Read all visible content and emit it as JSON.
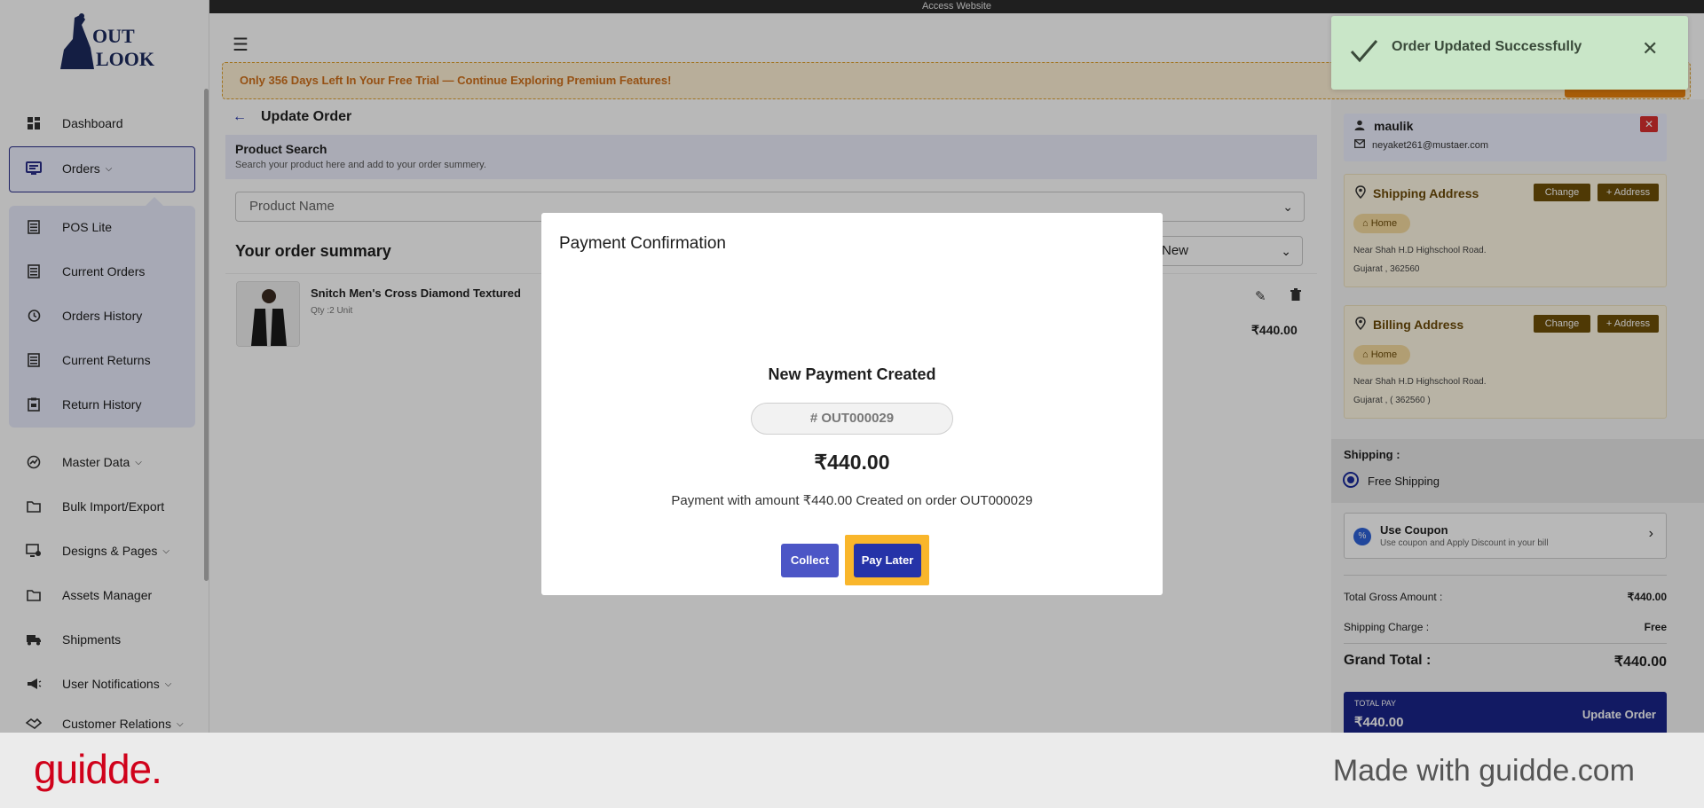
{
  "topbar": {
    "access_label": "Access Website"
  },
  "trial_banner": {
    "text": "Only 356 Days Left In Your Free Trial — Continue Exploring Premium Features!"
  },
  "sidebar": {
    "items": [
      {
        "label": "Dashboard",
        "icon": "dashboard-icon"
      },
      {
        "label": "Orders",
        "icon": "orders-icon"
      },
      {
        "label": "Master Data",
        "icon": "master-data-icon"
      },
      {
        "label": "Bulk Import/Export",
        "icon": "folder-icon"
      },
      {
        "label": "Designs & Pages",
        "icon": "designs-icon"
      },
      {
        "label": "Assets Manager",
        "icon": "folder-icon"
      },
      {
        "label": "Shipments",
        "icon": "truck-icon"
      },
      {
        "label": "User Notifications",
        "icon": "megaphone-icon"
      },
      {
        "label": "Customer Relations",
        "icon": "handshake-icon"
      }
    ],
    "orders_sub": [
      {
        "label": "POS Lite"
      },
      {
        "label": "Current Orders"
      },
      {
        "label": "Orders History"
      },
      {
        "label": "Current Returns"
      },
      {
        "label": "Return History"
      }
    ]
  },
  "main": {
    "title": "Update Order",
    "product_search": {
      "title": "Product Search",
      "subtitle": "Search your product here and add to your order summery.",
      "placeholder": "Product Name"
    },
    "order_summary_title": "Your order summary",
    "status_value": "New",
    "item": {
      "name": "Snitch Men's Cross Diamond Textured",
      "qty": "Qty :2 Unit",
      "price": "₹440.00"
    }
  },
  "right_panel": {
    "customer": {
      "name": "maulik",
      "email": "neyaket261@mustaer.com"
    },
    "shipping_address": {
      "title": "Shipping Address",
      "change": "Change",
      "add": "+ Address",
      "tag": "Home",
      "line1": "Near Shah H.D Highschool Road.",
      "line2": "Gujarat , 362560"
    },
    "billing_address": {
      "title": "Billing Address",
      "change": "Change",
      "add": "+ Address",
      "tag": "Home",
      "line1": "Near Shah H.D Highschool Road.",
      "line2": "Gujarat , ( 362560 )"
    },
    "shipping": {
      "label": "Shipping :",
      "option": "Free Shipping"
    },
    "coupon": {
      "title": "Use Coupon",
      "subtitle": "Use coupon and Apply Discount in your bill"
    },
    "totals": {
      "gross_label": "Total Gross Amount :",
      "gross_value": "₹440.00",
      "shipping_label": "Shipping Charge :",
      "shipping_value": "Free",
      "grand_label": "Grand Total :",
      "grand_value": "₹440.00"
    },
    "update_button": {
      "label": "TOTAL PAY",
      "amount": "₹440.00",
      "text": "Update Order"
    }
  },
  "modal": {
    "title": "Payment Confirmation",
    "heading": "New Payment Created",
    "order_id": "# OUT000029",
    "amount": "₹440.00",
    "message": "Payment with amount ₹440.00 Created on order OUT000029",
    "collect_label": "Collect",
    "pay_later_label": "Pay Later"
  },
  "toast": {
    "message": "Order Updated Successfully"
  },
  "footer": {
    "brand": "guidde.",
    "made_with": "Made with guidde.com"
  },
  "colors": {
    "primary": "#1a2489",
    "accent_brown": "#6e4f08",
    "highlight": "#f9b62b",
    "trial_text": "#d0711c",
    "brand_red": "#d0021b"
  }
}
